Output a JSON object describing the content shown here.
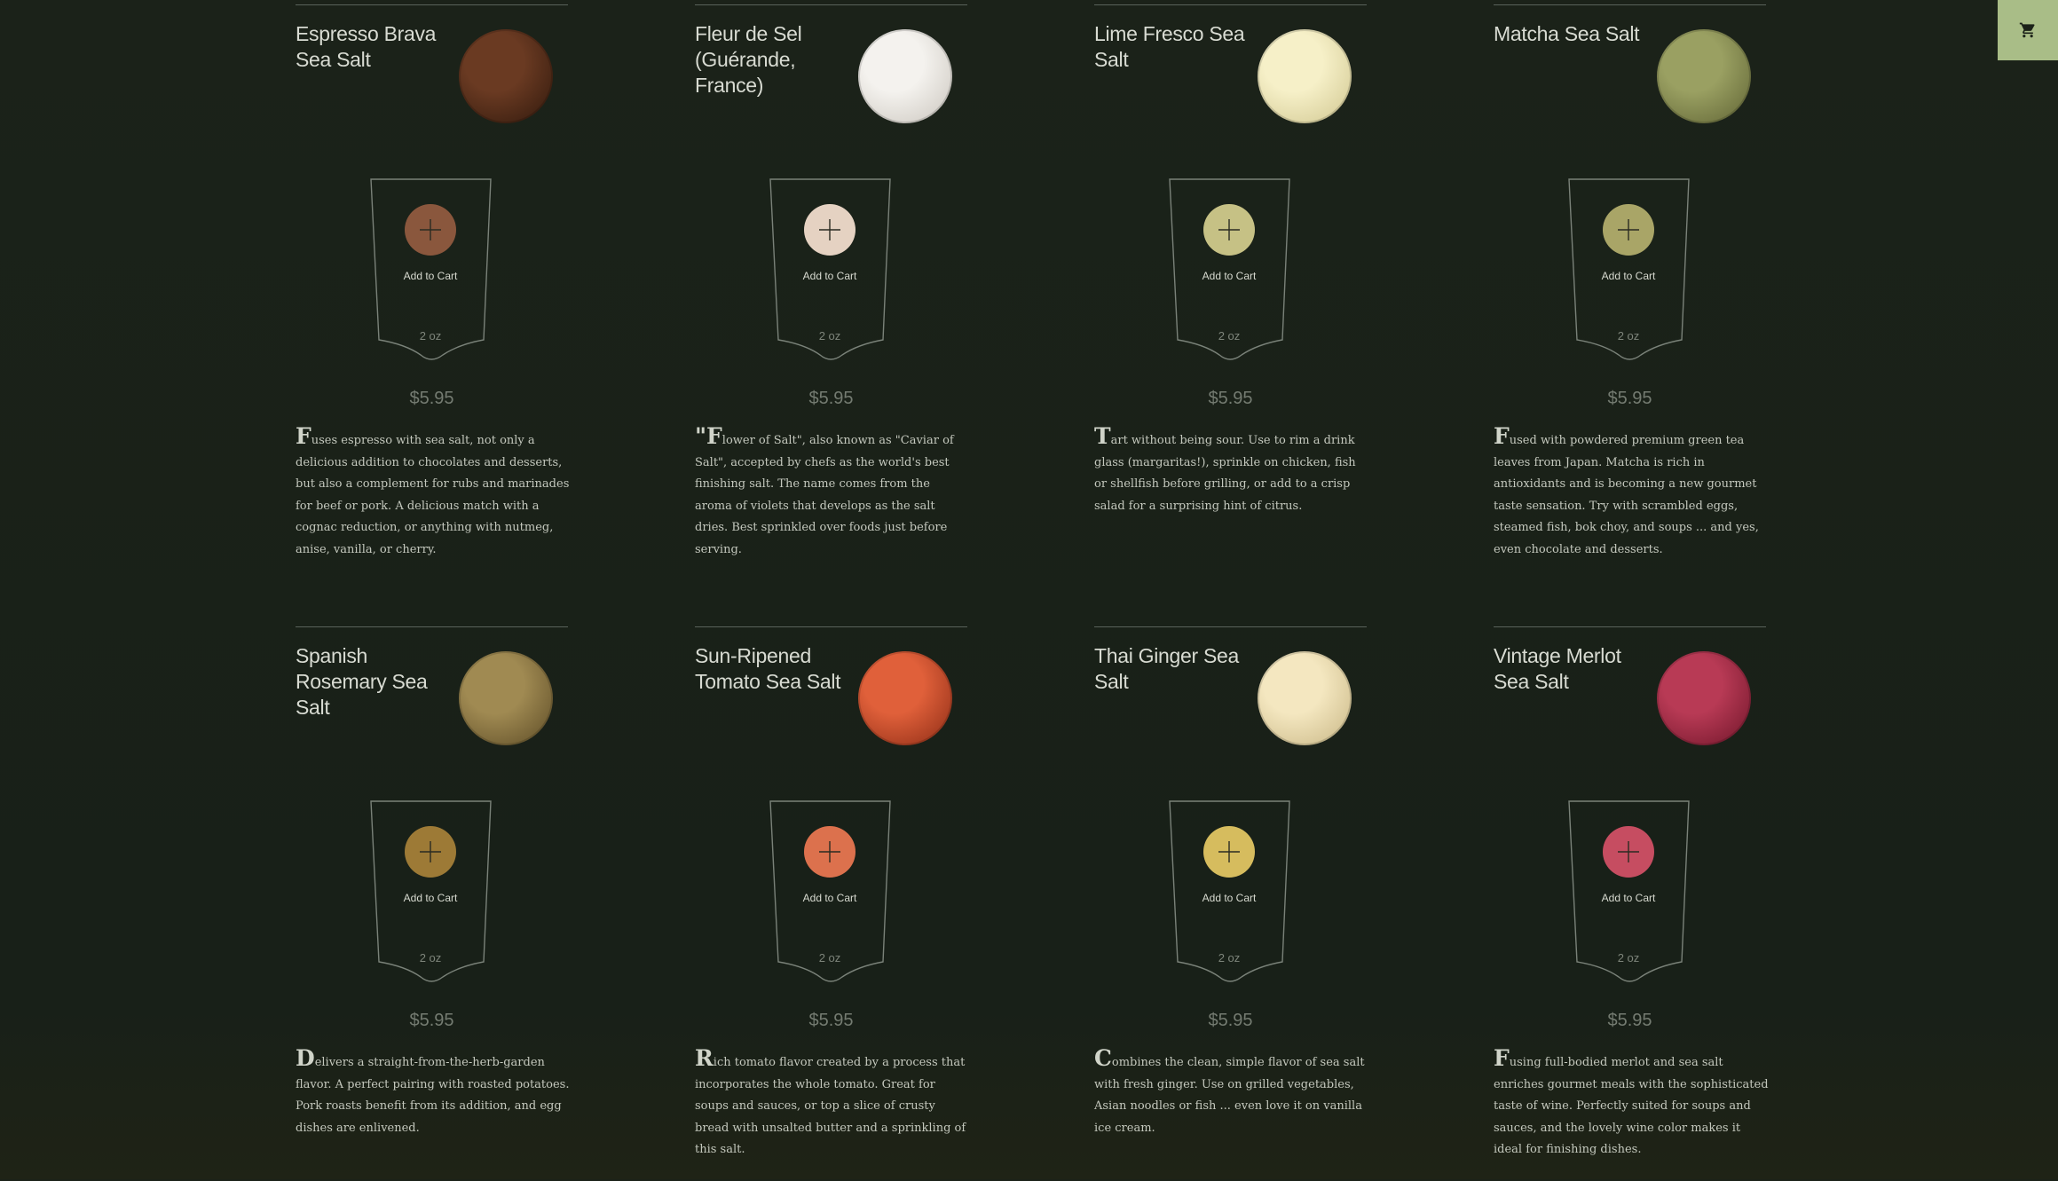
{
  "cart": {
    "icon": "cart-icon"
  },
  "products": [
    {
      "name": "Espresso Brava Sea Salt",
      "swatch": [
        "#6a3a22",
        "#2f180c"
      ],
      "button_color": "#8a573d",
      "add_label": "Add to Cart",
      "size": "2 oz",
      "price": "$5.95",
      "description": "Fuses espresso with sea salt, not only a delicious addition to chocolates and desserts, but also a complement for rubs and marinades for beef or pork. A delicious match with a cognac reduction, or anything with nutmeg, anise, vanilla, or cherry."
    },
    {
      "name": "Fleur de Sel (Guérande, France)",
      "swatch": [
        "#f4f2ee",
        "#c9c4bc"
      ],
      "button_color": "#e5d2c2",
      "add_label": "Add to Cart",
      "size": "2 oz",
      "price": "$5.95",
      "description": "\"Flower of Salt\", also known as \"Caviar of Salt\", accepted by chefs as the world's best finishing salt. The name comes from the aroma of violets that develops as the salt dries. Best sprinkled over foods just before serving."
    },
    {
      "name": "Lime Fresco Sea Salt",
      "swatch": [
        "#f6f0c8",
        "#cfc58e"
      ],
      "button_color": "#c6c185",
      "add_label": "Add to Cart",
      "size": "2 oz",
      "price": "$5.95",
      "description": "Tart without being sour. Use to rim a drink glass (margaritas!), sprinkle on chicken, fish or shellfish before grilling, or add to a crisp salad for a surprising hint of citrus."
    },
    {
      "name": "Matcha Sea Salt",
      "swatch": [
        "#9aa062",
        "#5e6233"
      ],
      "button_color": "#a9a567",
      "add_label": "Add to Cart",
      "size": "2 oz",
      "price": "$5.95",
      "description": "Fused with powdered premium green tea leaves from Japan. Matcha is rich in antioxidants and is becoming a new gourmet taste sensation. Try with scrambled eggs, steamed fish, bok choy, and soups ... and yes, even chocolate and desserts."
    },
    {
      "name": "Spanish Rosemary Sea Salt",
      "swatch": [
        "#a08a52",
        "#5b4a25"
      ],
      "button_color": "#9d7a36",
      "add_label": "Add to Cart",
      "size": "2 oz",
      "price": "$5.95",
      "description": "Delivers a straight-from-the-herb-garden flavor. A perfect pairing with roasted potatoes. Pork roasts benefit from its addition, and egg dishes are enlivened."
    },
    {
      "name": "Sun-Ripened Tomato Sea Salt",
      "swatch": [
        "#e0603a",
        "#8a2a14"
      ],
      "button_color": "#dc714d",
      "add_label": "Add to Cart",
      "size": "2 oz",
      "price": "$5.95",
      "description": "Rich tomato flavor created by a process that incorporates the whole tomato. Great for soups and sauces, or top a slice of crusty bread with unsalted butter and a sprinkling of this salt."
    },
    {
      "name": "Thai Ginger Sea Salt",
      "swatch": [
        "#f4e7c0",
        "#c7b583"
      ],
      "button_color": "#d6bc5e",
      "add_label": "Add to Cart",
      "size": "2 oz",
      "price": "$5.95",
      "description": "Combines the clean, simple flavor of sea salt with fresh ginger. Use on grilled vegetables, Asian noodles or fish ... even love it on vanilla ice cream."
    },
    {
      "name": "Vintage Merlot Sea Salt",
      "swatch": [
        "#b83a55",
        "#6d1428"
      ],
      "button_color": "#c64d61",
      "add_label": "Add to Cart",
      "size": "2 oz",
      "price": "$5.95",
      "description": "Fusing full-bodied merlot and sea salt enriches gourmet meals with the sophisticated taste of wine. Perfectly suited for soups and sauces, and the lovely wine color makes it ideal for finishing dishes."
    }
  ]
}
